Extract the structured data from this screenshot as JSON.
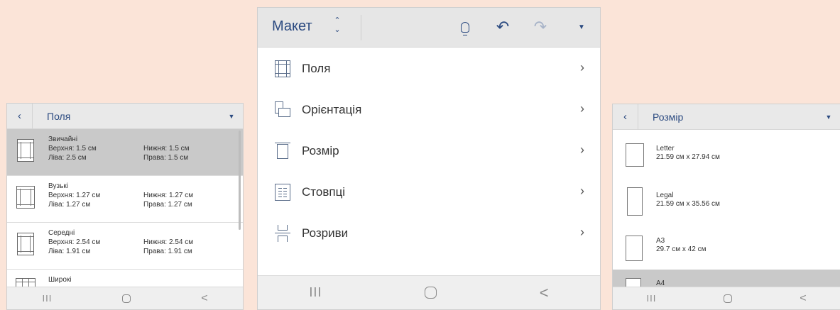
{
  "margins_panel": {
    "title": "Поля",
    "back_icon": "chevron-left-icon",
    "dropdown_icon": "caret-down-icon",
    "items": [
      {
        "name": "Звичайні",
        "top": "Верхня: 1.5 см",
        "bottom": "Нижня: 1.5 см",
        "left": "Ліва: 2.5 см",
        "right": "Права: 1.5 см",
        "selected": true
      },
      {
        "name": "Вузькі",
        "top": "Верхня: 1.27 см",
        "bottom": "Нижня: 1.27 см",
        "left": "Ліва: 1.27 см",
        "right": "Права: 1.27 см",
        "selected": false
      },
      {
        "name": "Середні",
        "top": "Верхня: 2.54 см",
        "bottom": "Нижня: 2.54 см",
        "left": "Ліва: 1.91 см",
        "right": "Права: 1.91 см",
        "selected": false
      },
      {
        "name": "Широкі",
        "selected": false
      }
    ]
  },
  "layout_panel": {
    "title": "Макет",
    "toolbar_icons": [
      "up-down-chevron-icon",
      "lightbulb-icon",
      "undo-icon",
      "redo-icon",
      "caret-down-icon"
    ],
    "menu": [
      {
        "label": "Поля",
        "icon": "margins-icon"
      },
      {
        "label": "Орієнтація",
        "icon": "orientation-icon"
      },
      {
        "label": "Розмір",
        "icon": "page-size-icon"
      },
      {
        "label": "Стовпці",
        "icon": "columns-icon"
      },
      {
        "label": "Розриви",
        "icon": "breaks-icon"
      }
    ]
  },
  "size_panel": {
    "title": "Розмір",
    "back_icon": "chevron-left-icon",
    "dropdown_icon": "caret-down-icon",
    "items": [
      {
        "name": "Letter",
        "dims": "21.59 см x 27.94 см",
        "selected": false
      },
      {
        "name": "Legal",
        "dims": "21.59 см x 35.56 см",
        "selected": false
      },
      {
        "name": "A3",
        "dims": "29.7 см x 42 см",
        "selected": false
      },
      {
        "name": "A4",
        "selected": true
      }
    ]
  },
  "system_nav": {
    "recent": "III",
    "home_icon": "home-icon",
    "back": "<"
  },
  "colors": {
    "background": "#fbe4d8",
    "accent": "#2b4a80",
    "selected_row": "#c9c9c9",
    "header": "#e6e6e6"
  }
}
